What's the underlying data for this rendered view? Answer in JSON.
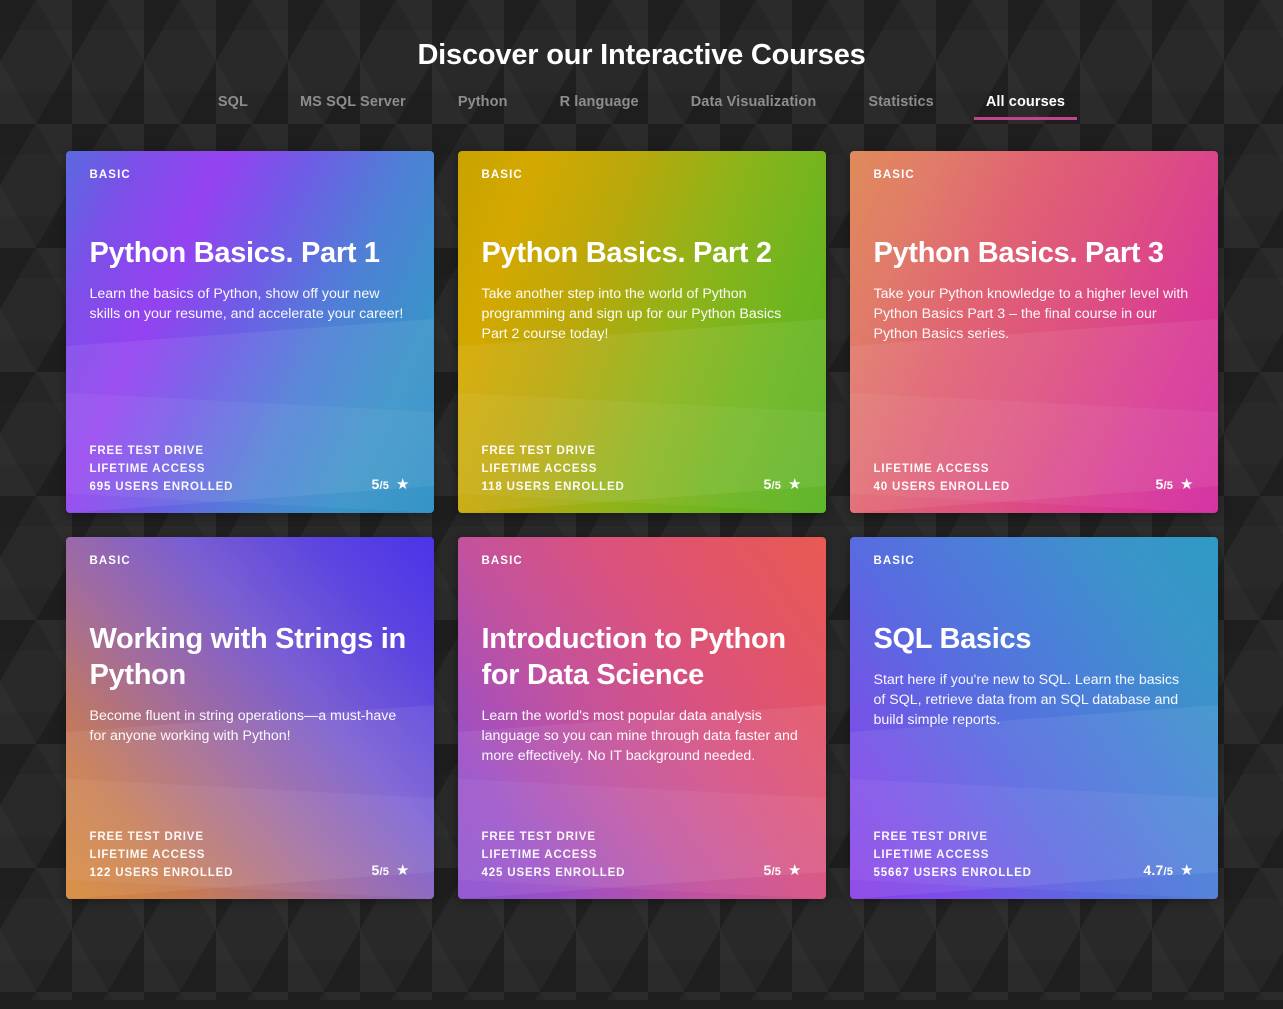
{
  "header": {
    "title": "Discover our Interactive Courses"
  },
  "tabs": [
    {
      "label": "SQL",
      "active": false
    },
    {
      "label": "MS SQL Server",
      "active": false
    },
    {
      "label": "Python",
      "active": false
    },
    {
      "label": "R language",
      "active": false
    },
    {
      "label": "Data Visualization",
      "active": false
    },
    {
      "label": "Statistics",
      "active": false
    },
    {
      "label": "All courses",
      "active": true
    }
  ],
  "accent_color": "#c2448c",
  "icons": {
    "star": "star-icon",
    "star_glyph": "★"
  },
  "labels": {
    "users_enrolled": "USERS ENROLLED",
    "rating_denominator": "/5"
  },
  "courses": [
    {
      "level": "BASIC",
      "title": "Python Basics. Part 1",
      "description": "Learn the basics of Python, show off your new skills on your resume, and accelerate your career!",
      "features": [
        "FREE TEST DRIVE",
        "LIFETIME ACCESS"
      ],
      "users_count": "695",
      "rating": "5"
    },
    {
      "level": "BASIC",
      "title": "Python Basics. Part 2",
      "description": "Take another step into the world of Python programming and sign up for our Python Basics Part 2 course today!",
      "features": [
        "FREE TEST DRIVE",
        "LIFETIME ACCESS"
      ],
      "users_count": "118",
      "rating": "5"
    },
    {
      "level": "BASIC",
      "title": "Python Basics. Part 3",
      "description": "Take your Python knowledge to a higher level with Python Basics Part 3 – the final course in our Python Basics series.",
      "features": [
        "LIFETIME ACCESS"
      ],
      "users_count": "40",
      "rating": "5"
    },
    {
      "level": "BASIC",
      "title": "Working with Strings in Python",
      "description": "Become fluent in string operations—a must-have for anyone working with Python!",
      "features": [
        "FREE TEST DRIVE",
        "LIFETIME ACCESS"
      ],
      "users_count": "122",
      "rating": "5"
    },
    {
      "level": "BASIC",
      "title": "Introduction to Python for Data Science",
      "description": "Learn the world's most popular data analysis language so you can mine through data faster and more effectively. No IT background needed.",
      "features": [
        "FREE TEST DRIVE",
        "LIFETIME ACCESS"
      ],
      "users_count": "425",
      "rating": "5"
    },
    {
      "level": "BASIC",
      "title": "SQL Basics",
      "description": "Start here if you're new to SQL. Learn the basics of SQL, retrieve data from an SQL database and build simple reports.",
      "features": [
        "FREE TEST DRIVE",
        "LIFETIME ACCESS"
      ],
      "users_count": "55667",
      "rating": "4.7"
    }
  ]
}
